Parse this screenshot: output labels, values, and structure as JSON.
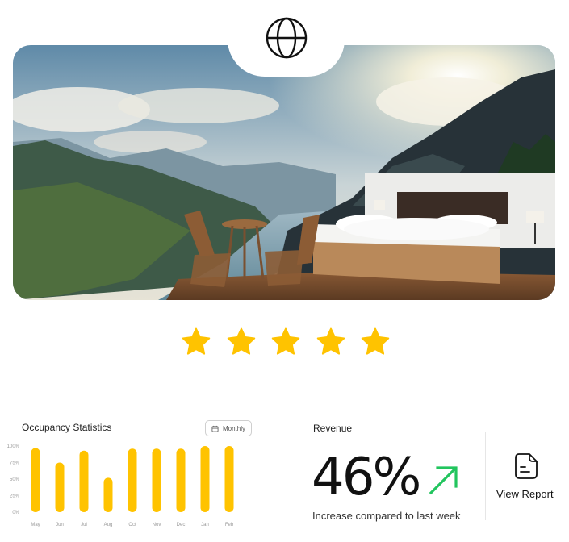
{
  "hero": {
    "icon": "globe-icon"
  },
  "rating": {
    "stars": 5,
    "max": 5,
    "color": "#FFC300"
  },
  "occupancy": {
    "title": "Occupancy Statistics",
    "period_label": "Monthly",
    "period_icon": "calendar-icon"
  },
  "chart_data": {
    "type": "bar",
    "title": "Occupancy Statistics",
    "categories": [
      "May",
      "Jun",
      "Jul",
      "Aug",
      "Oct",
      "Nov",
      "Dec",
      "Jan",
      "Feb"
    ],
    "values": [
      97,
      75,
      93,
      52,
      96,
      96,
      96,
      100,
      100
    ],
    "yticks": [
      "100%",
      "75%",
      "50%",
      "25%",
      "0%"
    ],
    "ylim": [
      0,
      100
    ],
    "bar_color": "#FFC300",
    "grid": false
  },
  "revenue": {
    "title": "Revenue",
    "value": "46%",
    "caption": "Increase compared to last week",
    "trend_icon": "arrow-up-right-icon",
    "trend_color": "#22C55E"
  },
  "report": {
    "label": "View Report",
    "icon": "document-icon"
  }
}
